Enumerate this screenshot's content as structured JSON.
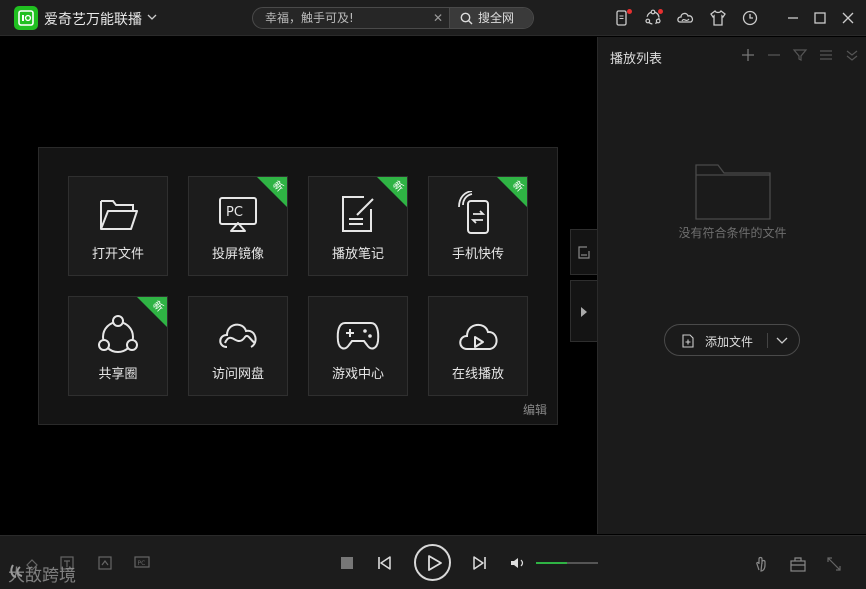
{
  "app": {
    "title": "爱奇艺万能联播"
  },
  "search": {
    "placeholder": "幸福，触手可及!",
    "button_label": "搜全网"
  },
  "colors": {
    "accent": "#2fb344",
    "background": "#000000",
    "panel": "#1b1b1b"
  },
  "titlebar_icons": [
    "phone-notify-icon",
    "share-circle-icon",
    "cloud-icon",
    "skin-shirt-icon",
    "history-clock-icon",
    "minimize-icon",
    "maximize-icon",
    "close-icon"
  ],
  "tiles": [
    {
      "label": "打开文件",
      "icon": "folder-open-icon",
      "is_new": false
    },
    {
      "label": "投屏镜像",
      "icon": "pc-cast-icon",
      "is_new": true
    },
    {
      "label": "播放笔记",
      "icon": "note-icon",
      "is_new": true
    },
    {
      "label": "手机快传",
      "icon": "phone-transfer-icon",
      "is_new": true
    },
    {
      "label": "共享圈",
      "icon": "share-circle-icon",
      "is_new": true
    },
    {
      "label": "访问网盘",
      "icon": "cloud-drive-icon",
      "is_new": false
    },
    {
      "label": "游戏中心",
      "icon": "gamepad-icon",
      "is_new": false
    },
    {
      "label": "在线播放",
      "icon": "cloud-play-icon",
      "is_new": false
    }
  ],
  "new_badge": "新",
  "panel_edit": "编辑",
  "playlist": {
    "title": "播放列表",
    "empty_text": "没有符合条件的文件",
    "add_file_label": "添加文件"
  },
  "bottom": {
    "watermark": "大敌跨境",
    "volume_level": 0.5
  }
}
